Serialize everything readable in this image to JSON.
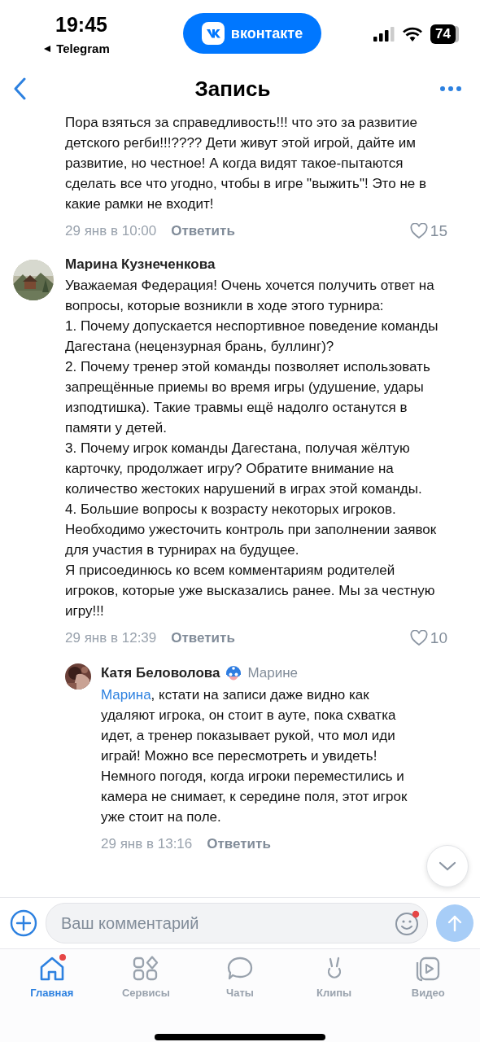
{
  "status_bar": {
    "time": "19:45",
    "back_app": "Telegram",
    "app_pill": "вконтакте",
    "battery": "74"
  },
  "header": {
    "title": "Запись"
  },
  "comments": [
    {
      "paragraphs": [
        "Пора взяться за справедливость!!! что это за развитие детского регби!!!???? Дети живут этой игрой, дайте им развитие, но честное! А когда видят такое-пытаются сделать все что угодно, чтобы в игре \"выжить\"! Это не в какие рамки не входит!"
      ],
      "date": "29 янв в 10:00",
      "reply": "Ответить",
      "likes": "15"
    },
    {
      "author": "Марина Кузнеченкова",
      "paragraphs": [
        "Уважаемая Федерация! Очень хочется получить ответ на вопросы, которые возникли в ходе этого турнира:",
        "1. Почему допускается неспортивное поведение команды Дагестана (нецензурная брань, буллинг)?",
        "2. Почему тренер этой команды позволяет использовать запрещённые приемы во время игры (удушение, удары изподтишка). Такие травмы ещё надолго останутся в памяти у детей.",
        "3. Почему игрок команды Дагестана, получая жёлтую карточку, продолжает игру? Обратите внимание на количество жестоких нарушений в играх этой команды.",
        "4. Большие вопросы к возрасту некоторых игроков. Необходимо ужесточить контроль при заполнении заявок для участия в турнирах на будущее.",
        "Я присоединюсь ко всем комментариям родителей игроков, которые уже высказались ранее. Мы за честную игру!!!"
      ],
      "date": "29 янв в 12:39",
      "reply": "Ответить",
      "likes": "10"
    }
  ],
  "reply_comment": {
    "author": "Катя Беловолова",
    "reply_to": "Марине",
    "mention": "Марина",
    "text": ", кстати на записи даже видно как удаляют игрока, он стоит в ауте, пока схватка идет, а тренер показывает рукой, что мол иди играй! Можно все пересмотреть и увидеть! Немного погодя, когда игроки переместились и камера не снимает, к середине поля, этот игрок уже стоит на поле.",
    "date": "29 янв в 13:16",
    "reply": "Ответить"
  },
  "composer": {
    "placeholder": "Ваш комментарий"
  },
  "tabs": [
    {
      "label": "Главная",
      "selected": true,
      "badge": true
    },
    {
      "label": "Сервисы",
      "selected": false,
      "badge": false
    },
    {
      "label": "Чаты",
      "selected": false,
      "badge": false
    },
    {
      "label": "Клипы",
      "selected": false,
      "badge": false
    },
    {
      "label": "Видео",
      "selected": false,
      "badge": false
    }
  ]
}
